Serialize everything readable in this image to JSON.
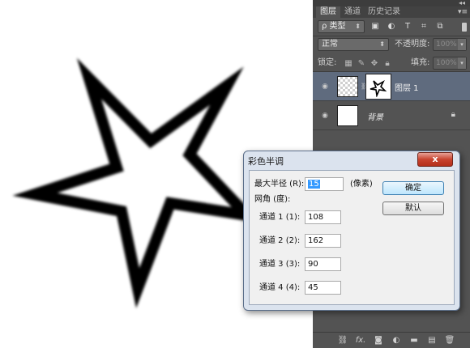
{
  "panel": {
    "tabs": [
      "图层",
      "通道",
      "历史记录"
    ],
    "filter": {
      "kind_label": "ρ 类型",
      "icons": [
        "image-filter-icon",
        "adjustment-filter-icon",
        "type-filter-icon",
        "shape-filter-icon",
        "smart-object-filter-icon"
      ]
    },
    "blend_mode": "正常",
    "opacity_label": "不透明度:",
    "opacity_value": "100%",
    "lock_label": "锁定:",
    "fill_label": "填充:",
    "fill_value": "100%",
    "layers": [
      {
        "name": "图层 1",
        "selected": true
      },
      {
        "name": "背景",
        "selected": false,
        "locked": true
      }
    ],
    "bottom_icons": [
      "link-layers-icon",
      "fx-icon",
      "add-mask-icon",
      "new-fill-adjustment-icon",
      "new-group-icon",
      "new-layer-icon",
      "delete-icon"
    ],
    "fx_label": "fx."
  },
  "dialog": {
    "title": "彩色半调",
    "close_label": "x",
    "max_radius_label": "最大半径 (R):",
    "max_radius_value": "15",
    "unit_label": "(像素)",
    "angle_label": "网角 (度):",
    "channels": [
      {
        "label": "通道 1 (1):",
        "value": "108"
      },
      {
        "label": "通道 2 (2):",
        "value": "162"
      },
      {
        "label": "通道 3 (3):",
        "value": "90"
      },
      {
        "label": "通道 4 (4):",
        "value": "45"
      }
    ],
    "ok_label": "确定",
    "default_label": "默认"
  },
  "colors": {
    "panel_bg": "#535353",
    "selected_layer": "#5f6b7e",
    "dialog_bg": "#f0f0f0",
    "close_red": "#c8432f"
  }
}
